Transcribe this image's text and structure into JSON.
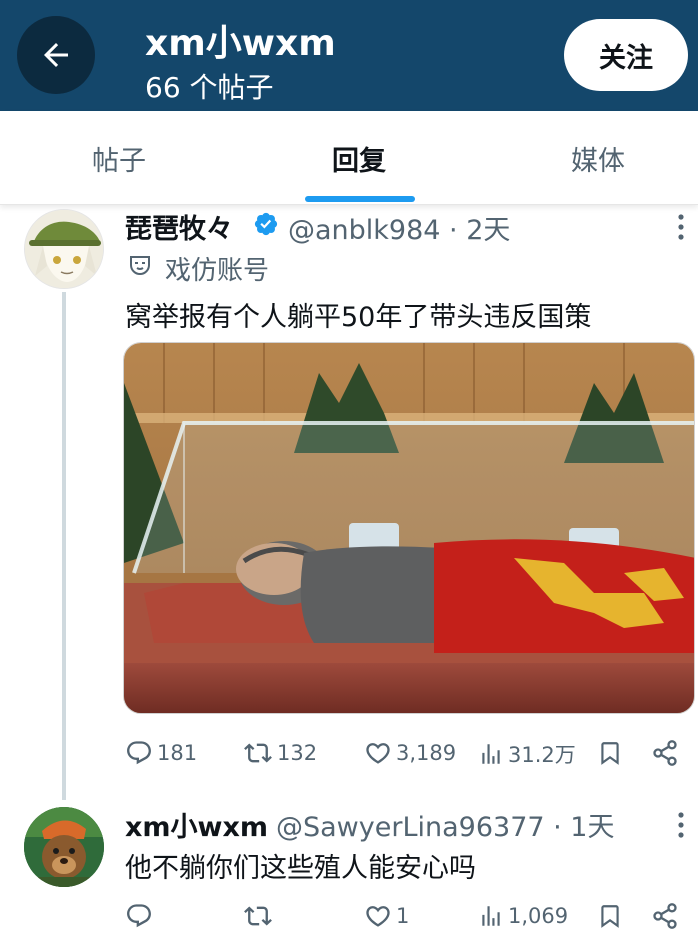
{
  "header": {
    "title": "xm小wxm",
    "subtitle": "66 个帖子",
    "follow_label": "关注",
    "background": "#14476b"
  },
  "tabs": [
    {
      "label": "帖子",
      "active": false
    },
    {
      "label": "回复",
      "active": true
    },
    {
      "label": "媒体",
      "active": false
    }
  ],
  "accent": "#1d9bf0",
  "posts": [
    {
      "display_name": "琵琶牧々",
      "handle_time": "@anblk984 · 2天",
      "verified": true,
      "parody_label": "戏仿账号",
      "text": "窝举报有个人躺平50年了带头违反国策",
      "has_media": true,
      "stats": {
        "replies": "181",
        "reposts": "132",
        "likes": "3,189",
        "views": "31.2万"
      }
    },
    {
      "display_name": "xm小wxm",
      "handle_time": "@SawyerLina96377 · 1天",
      "verified": false,
      "text": "他不躺你们这些殖人能安心吗",
      "has_media": false,
      "stats": {
        "replies": "",
        "reposts": "",
        "likes": "1",
        "views": "1,069"
      }
    }
  ]
}
